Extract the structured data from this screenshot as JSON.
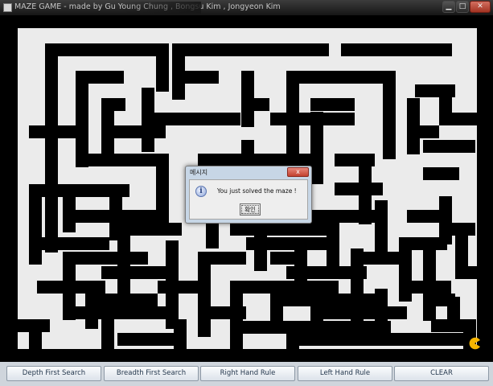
{
  "window": {
    "title": "MAZE GAME - made by Gu Young Chung , Bongsu Kim , Jongyeon Kim",
    "controls": {
      "minimize": "▁",
      "maximize": "□",
      "close": "✕"
    }
  },
  "toolbar": {
    "buttons": [
      {
        "label": "Depth First Search"
      },
      {
        "label": "Breadth First Search"
      },
      {
        "label": "Right Hand Rule"
      },
      {
        "label": "Left Hand Rule"
      },
      {
        "label": "CLEAR"
      }
    ]
  },
  "dialog": {
    "title": "메시지",
    "close_label": "x",
    "icon": "info-icon",
    "icon_glyph": "i",
    "message": "You just solved the maze !",
    "ok_label": "확인"
  },
  "maze": {
    "wall_color": "#000000",
    "path_color": "#ebebeb",
    "player_color": "#f7b500"
  }
}
